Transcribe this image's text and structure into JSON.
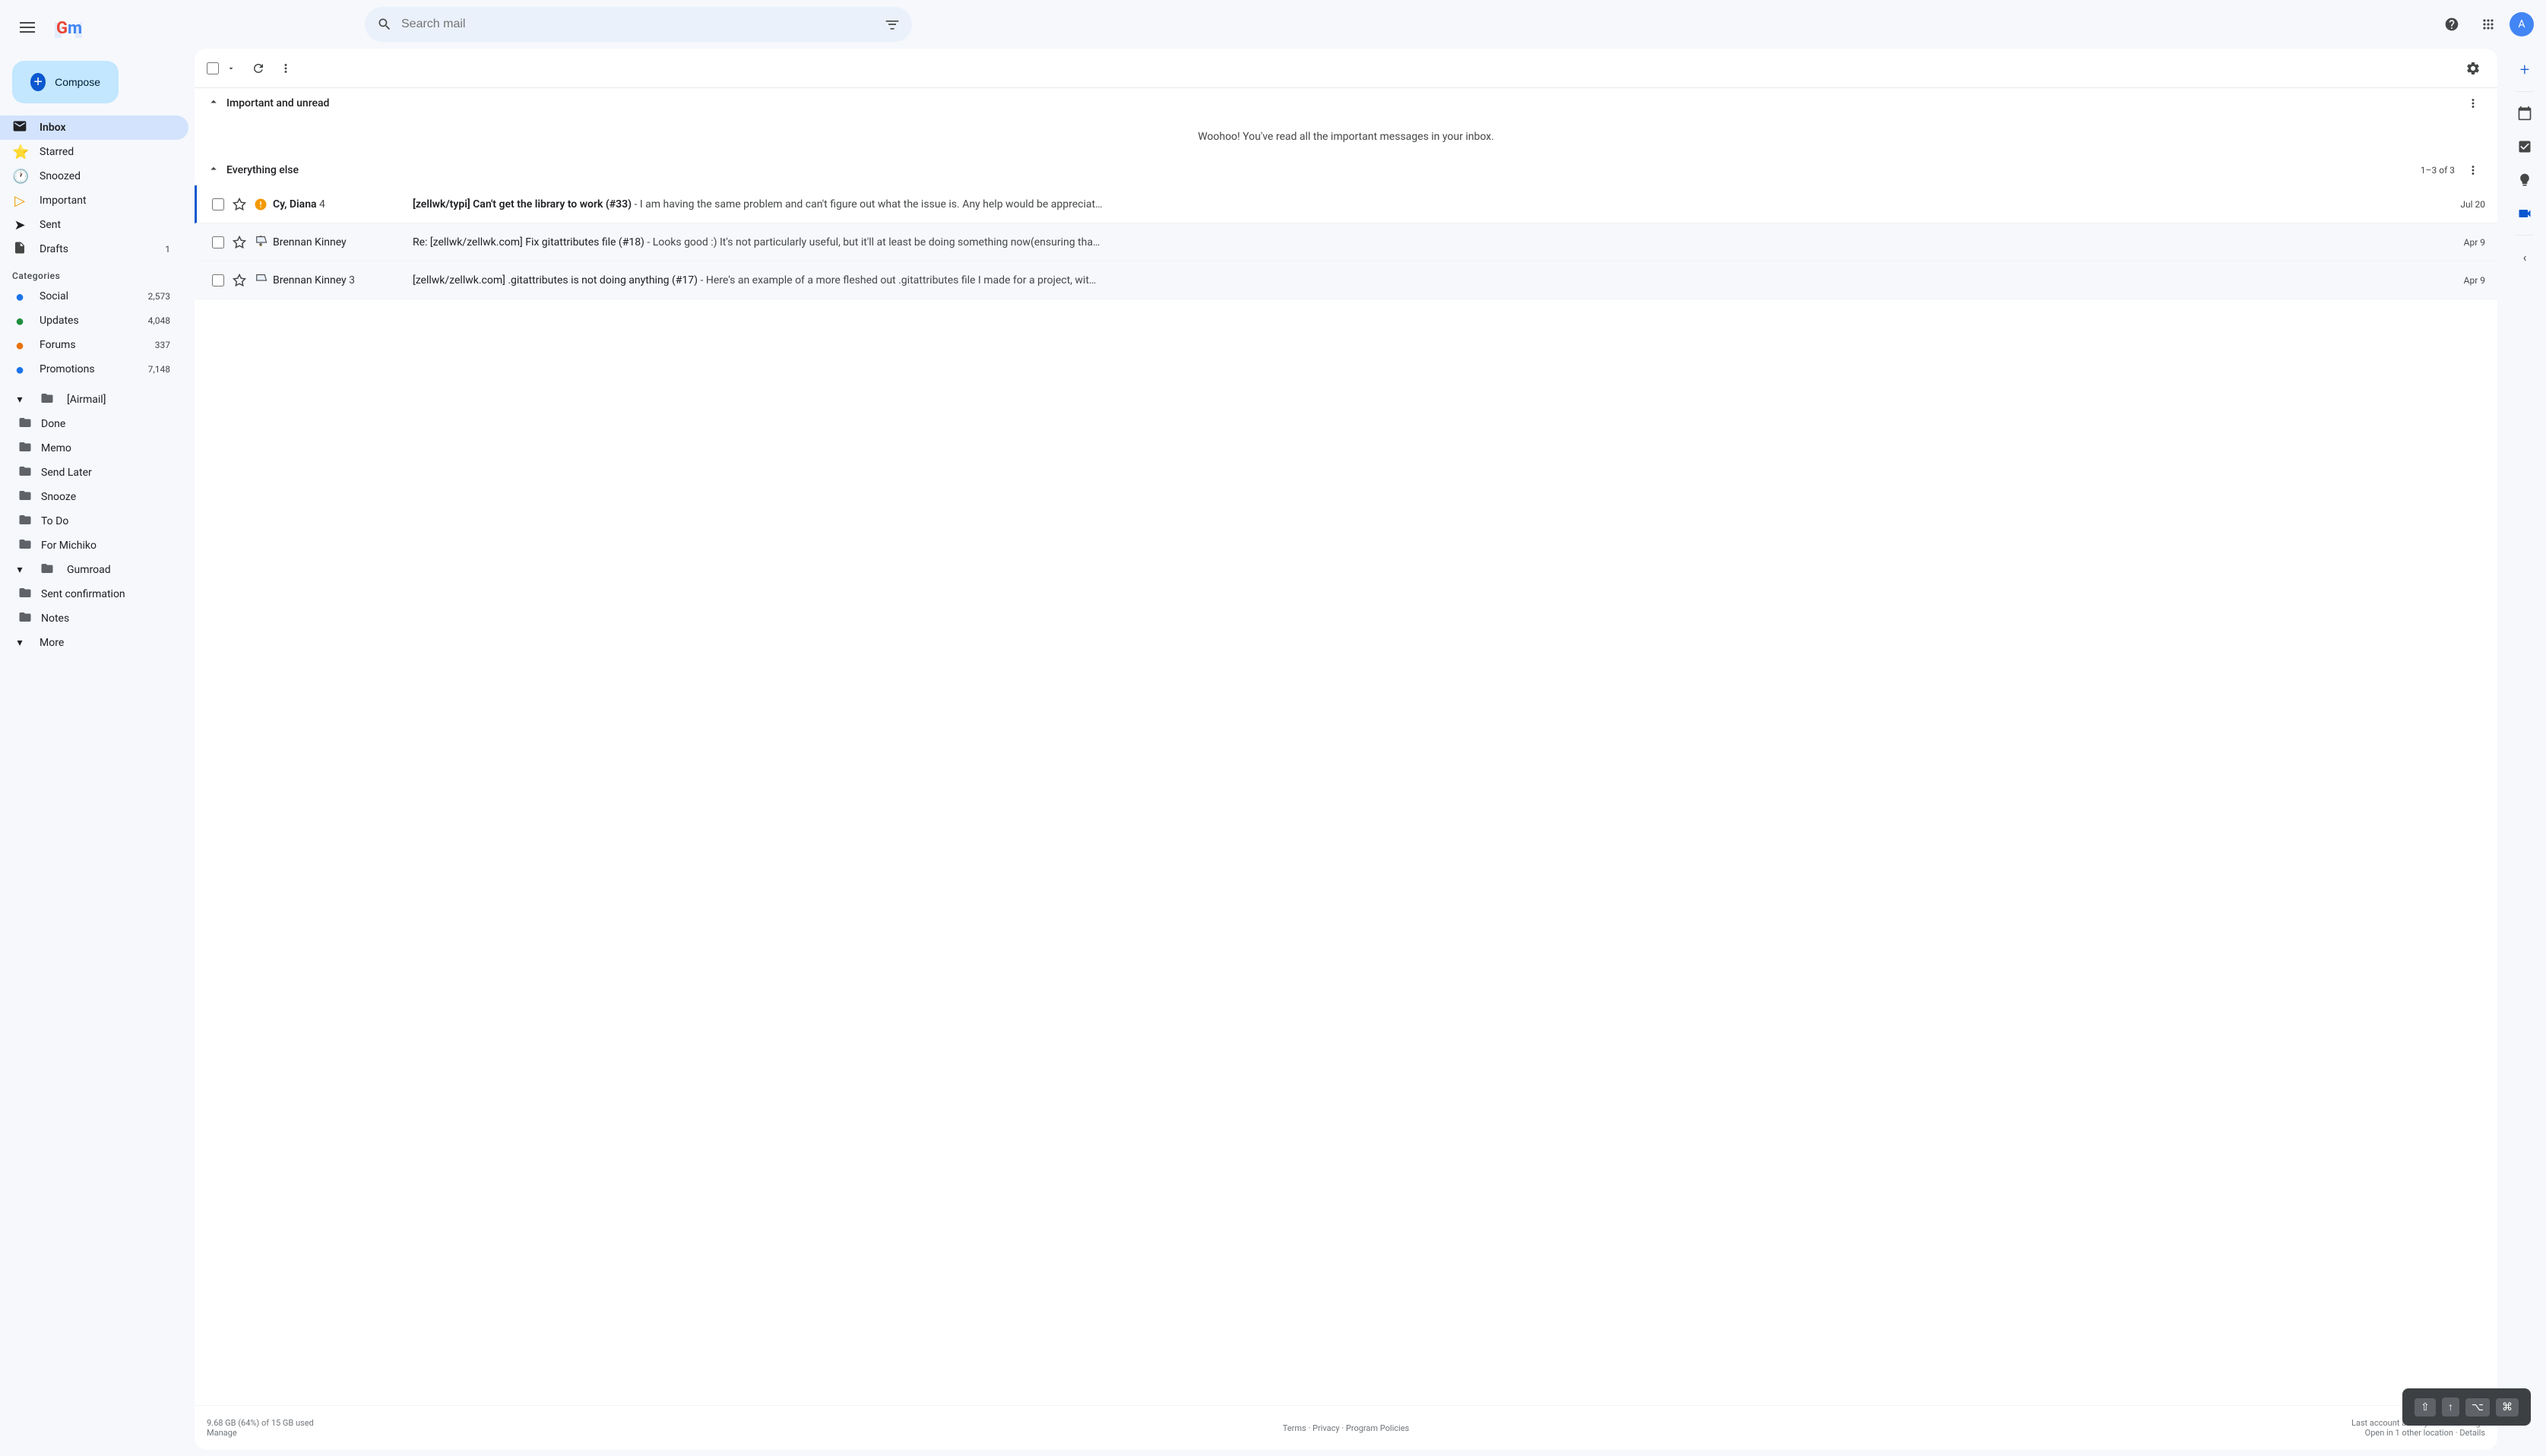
{
  "header": {
    "search_placeholder": "Search mail",
    "hamburger_icon": "☰"
  },
  "compose": {
    "label": "Compose",
    "plus": "+"
  },
  "sidebar": {
    "nav_items": [
      {
        "id": "inbox",
        "label": "Inbox",
        "icon": "📥",
        "active": true,
        "count": null
      },
      {
        "id": "starred",
        "label": "Starred",
        "icon": "☆",
        "active": false,
        "count": null
      },
      {
        "id": "snoozed",
        "label": "Snoozed",
        "icon": "🕐",
        "active": false,
        "count": null
      },
      {
        "id": "important",
        "label": "Important",
        "icon": "▷",
        "active": false,
        "count": null
      },
      {
        "id": "sent",
        "label": "Sent",
        "icon": "➤",
        "active": false,
        "count": null
      },
      {
        "id": "drafts",
        "label": "Drafts",
        "icon": "📄",
        "active": false,
        "count": "1"
      }
    ],
    "categories_label": "Categories",
    "categories": [
      {
        "id": "social",
        "label": "Social",
        "color": "#1a73e8",
        "count": "2,573"
      },
      {
        "id": "updates",
        "label": "Updates",
        "color": "#1e8e3e",
        "count": "4,048"
      },
      {
        "id": "forums",
        "label": "Forums",
        "color": "#e8710a",
        "count": "337"
      },
      {
        "id": "promotions",
        "label": "Promotions",
        "color": "#1a73e8",
        "count": "7,148"
      }
    ],
    "labels": [
      {
        "id": "airmail",
        "label": "[Airmail]",
        "icon": "▾",
        "expandable": true
      },
      {
        "id": "done",
        "label": "Done",
        "icon": "📁"
      },
      {
        "id": "memo",
        "label": "Memo",
        "icon": "📁"
      },
      {
        "id": "send_later",
        "label": "Send Later",
        "icon": "📁"
      },
      {
        "id": "snooze",
        "label": "Snooze",
        "icon": "📁"
      },
      {
        "id": "to_do",
        "label": "To Do",
        "icon": "📁"
      },
      {
        "id": "for_michiko",
        "label": "For Michiko",
        "icon": "📁"
      },
      {
        "id": "gumroad",
        "label": "Gumroad",
        "icon": "▾",
        "expandable": true
      },
      {
        "id": "sent_confirmation",
        "label": "Sent confirmation",
        "icon": "📁"
      },
      {
        "id": "notes",
        "label": "Notes",
        "icon": "📁"
      },
      {
        "id": "more",
        "label": "More",
        "icon": "▾"
      }
    ]
  },
  "main": {
    "sections": [
      {
        "id": "important_unread",
        "title": "Important and unread",
        "collapsed": false,
        "empty_message": "Woohoo! You've read all the important messages in your inbox.",
        "emails": []
      },
      {
        "id": "everything_else",
        "title": "Everything else",
        "collapsed": false,
        "count": "1–3 of 3",
        "emails": [
          {
            "id": 1,
            "sender": "Cy, Diana",
            "sender_count": "4",
            "important": true,
            "starred": false,
            "subject": "[zellwk/typi] Can't get the library to work (#33)",
            "snippet": "- I am having the same problem and can't figure out what the issue is. Any help would be appreciat…",
            "date": "Jul 20",
            "unread": true,
            "has_border": true
          },
          {
            "id": 2,
            "sender": "Brennan Kinney",
            "sender_count": null,
            "important": false,
            "starred": false,
            "subject": "Re: [zellwk/zellwk.com] Fix gitattributes file (#18)",
            "snippet": "- Looks good :) It's not particularly useful, but it'll at least be doing something now(ensuring tha…",
            "date": "Apr 9",
            "unread": false,
            "has_border": false
          },
          {
            "id": 3,
            "sender": "Brennan Kinney",
            "sender_count": "3",
            "important": false,
            "starred": false,
            "subject": "[zellwk/zellwk.com] .gitattributes is not doing anything (#17)",
            "snippet": "- Here's an example of a more fleshed out .gitattributes file I made for a project, wit…",
            "date": "Apr 9",
            "unread": false,
            "has_border": false
          }
        ]
      }
    ],
    "footer": {
      "storage": "9.68 GB (64%) of 15 GB used",
      "manage": "Manage",
      "terms": "Terms",
      "privacy": "Privacy",
      "policies": "Program Policies",
      "last_activity": "Last account activity: 0 minutes ago",
      "open_location": "Open in 1 other location",
      "details": "Details"
    }
  },
  "right_panel": {
    "items": [
      {
        "id": "add",
        "icon": "+",
        "active": false
      },
      {
        "id": "calendar",
        "icon": "📅",
        "active": false
      },
      {
        "id": "tasks",
        "icon": "✓",
        "active": false
      },
      {
        "id": "keep",
        "icon": "💡",
        "active": false
      },
      {
        "id": "contacts",
        "icon": "👤",
        "active": false
      },
      {
        "id": "meet",
        "icon": "📹",
        "active": true
      }
    ]
  },
  "keyboard_popup": {
    "keys": [
      "⇧",
      "↑",
      "⌥",
      "⌘"
    ]
  }
}
